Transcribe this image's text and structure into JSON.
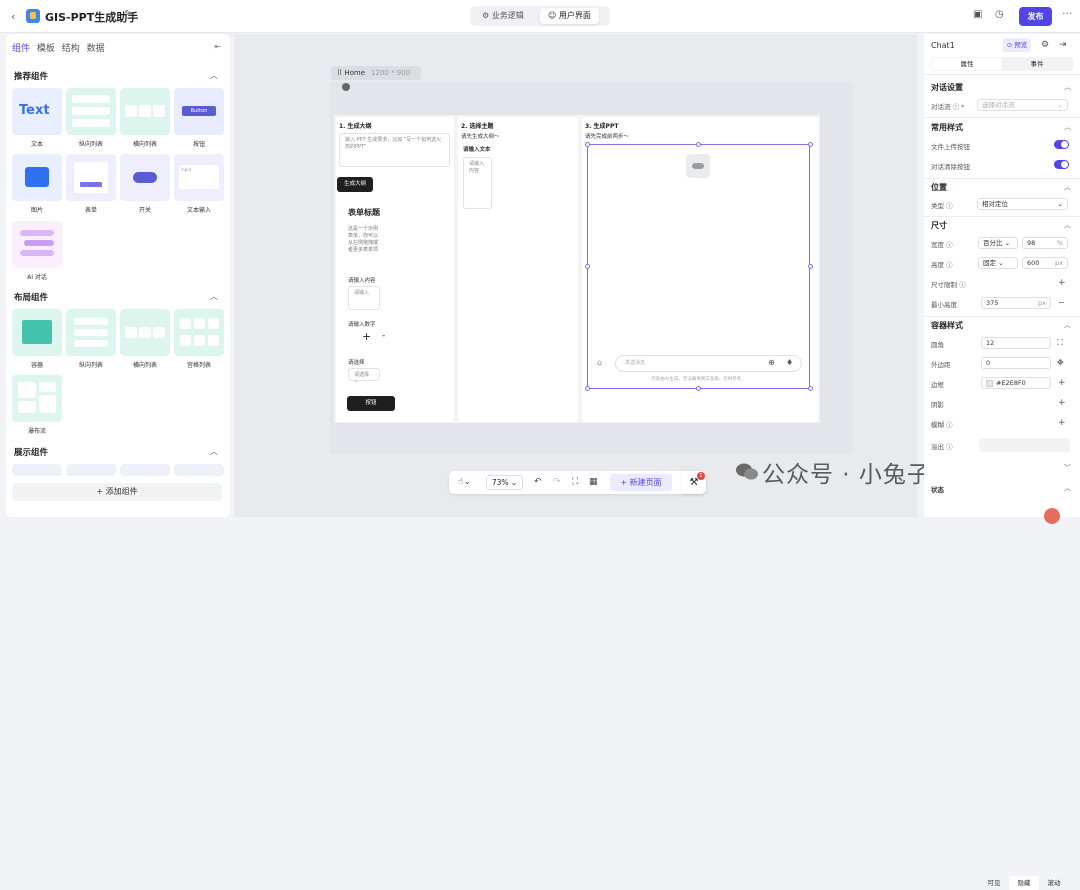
{
  "topbar": {
    "title": "GIS-PPT生成助手",
    "tabs": [
      "业务逻辑",
      "用户界面"
    ],
    "publish": "发布",
    "more": "···"
  },
  "left": {
    "tabs": [
      "组件",
      "模板",
      "结构",
      "数据"
    ],
    "sections": {
      "recommended": "推荐组件",
      "layout": "布局组件",
      "display": "展示组件"
    },
    "recommended_items": [
      "文本",
      "纵向列表",
      "横向列表",
      "按钮",
      "图片",
      "表单",
      "开关",
      "文本输入",
      "AI 对话"
    ],
    "layout_items": [
      "容器",
      "纵向列表",
      "横向列表",
      "宫格列表",
      "瀑布流"
    ],
    "card_text": "Text",
    "card_button": "Button",
    "card_input": "input",
    "add_component": "+ 添加组件"
  },
  "canvas": {
    "home_label": "Home",
    "home_size": "1200 * 900",
    "col1": {
      "title": "1. 生成大纲",
      "placeholder": "输入 PPT 生成要求，比如 \"写一个如何选火箭的PPT\"",
      "generate_btn": "生成大纲",
      "form_title": "表单标题",
      "form_desc": "这是一个示例表单，你可以从左侧拖拽或者更多表单项",
      "field1_label": "请输入内容",
      "field1_placeholder": "请输入",
      "field2_label": "请输入数字",
      "field3_label": "请选择",
      "field3_placeholder": "请选择",
      "submit_btn": "按钮"
    },
    "col2": {
      "title": "2. 选择主题",
      "subtitle": "请先生成大纲～",
      "input_label": "请输入文本",
      "input_placeholder": "请输入内容"
    },
    "col3": {
      "title": "3. 生成PPT",
      "subtitle": "请先完成前两步～",
      "chat_placeholder": "发送消息",
      "disclaimer": "内容由AI生成，无法确保真实准确，仅供参考。"
    },
    "zoom": "73%",
    "new_page": "+ 新建页面",
    "badge": "1",
    "watermark": "公众号 · 小兔子GIS"
  },
  "right": {
    "component": "Chat1",
    "preview": "预览",
    "tabs": [
      "属性",
      "事件"
    ],
    "dialog_settings": "对话设置",
    "dialog_flow_label": "对话流",
    "dialog_flow_placeholder": "选择对话流",
    "common_style": "常用样式",
    "file_upload": "文件上传按钮",
    "clear_chat": "对话清除按钮",
    "position": "位置",
    "type_label": "类型",
    "type_value": "相对定位",
    "size": "尺寸",
    "width_label": "宽度",
    "width_mode": "百分比",
    "width_value": "98",
    "width_unit": "%",
    "height_label": "高度",
    "height_mode": "固定",
    "height_value": "600",
    "height_unit": "px",
    "size_limit": "尺寸限制",
    "min_height_label": "最小高度",
    "min_height_value": "375",
    "min_height_unit": "px",
    "container_style": "容器样式",
    "radius_label": "圆角",
    "radius_value": "12",
    "margin_label": "外边距",
    "margin_value": "0",
    "border_label": "边框",
    "border_value": "#E2E8F0",
    "shadow_label": "阴影",
    "blur_label": "模糊",
    "overflow_label": "溢出",
    "overflow_options": [
      "可见",
      "隐藏",
      "滚动"
    ],
    "state_label": "状态"
  }
}
